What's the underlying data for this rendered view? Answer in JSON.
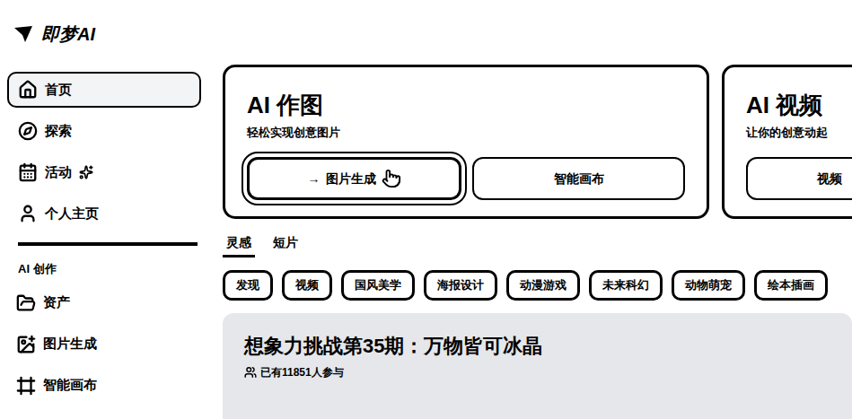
{
  "logo": "即梦AI",
  "sidebar": {
    "items": [
      {
        "label": "首页",
        "selected": true,
        "badge": false
      },
      {
        "label": "探索",
        "selected": false,
        "badge": false
      },
      {
        "label": "活动",
        "selected": false,
        "badge": true
      },
      {
        "label": "个人主页",
        "selected": false,
        "badge": false
      }
    ],
    "section_title": "AI 创作",
    "tools": [
      {
        "label": "资产"
      },
      {
        "label": "图片生成"
      },
      {
        "label": "智能画布"
      }
    ]
  },
  "cards": [
    {
      "title": "AI 作图",
      "subtitle": "轻松实现创意图片",
      "buttons": [
        {
          "label": "图片生成",
          "arrow": "→",
          "primary": true
        },
        {
          "label": "智能画布",
          "arrow": "",
          "primary": false
        }
      ]
    },
    {
      "title": "AI 视频",
      "subtitle": "让你的创意动起",
      "buttons": [
        {
          "label": "视频",
          "arrow": "",
          "primary": false
        }
      ]
    }
  ],
  "tabs": [
    {
      "label": "灵感",
      "selected": true
    },
    {
      "label": "短片",
      "selected": false
    }
  ],
  "categories": [
    "发现",
    "视频",
    "国风美学",
    "海报设计",
    "动漫游戏",
    "未来科幻",
    "动物萌宠",
    "绘本插画"
  ],
  "banner": {
    "title": "想象力挑战第35期：万物皆可冰晶",
    "participants": "已有11851人参与"
  }
}
